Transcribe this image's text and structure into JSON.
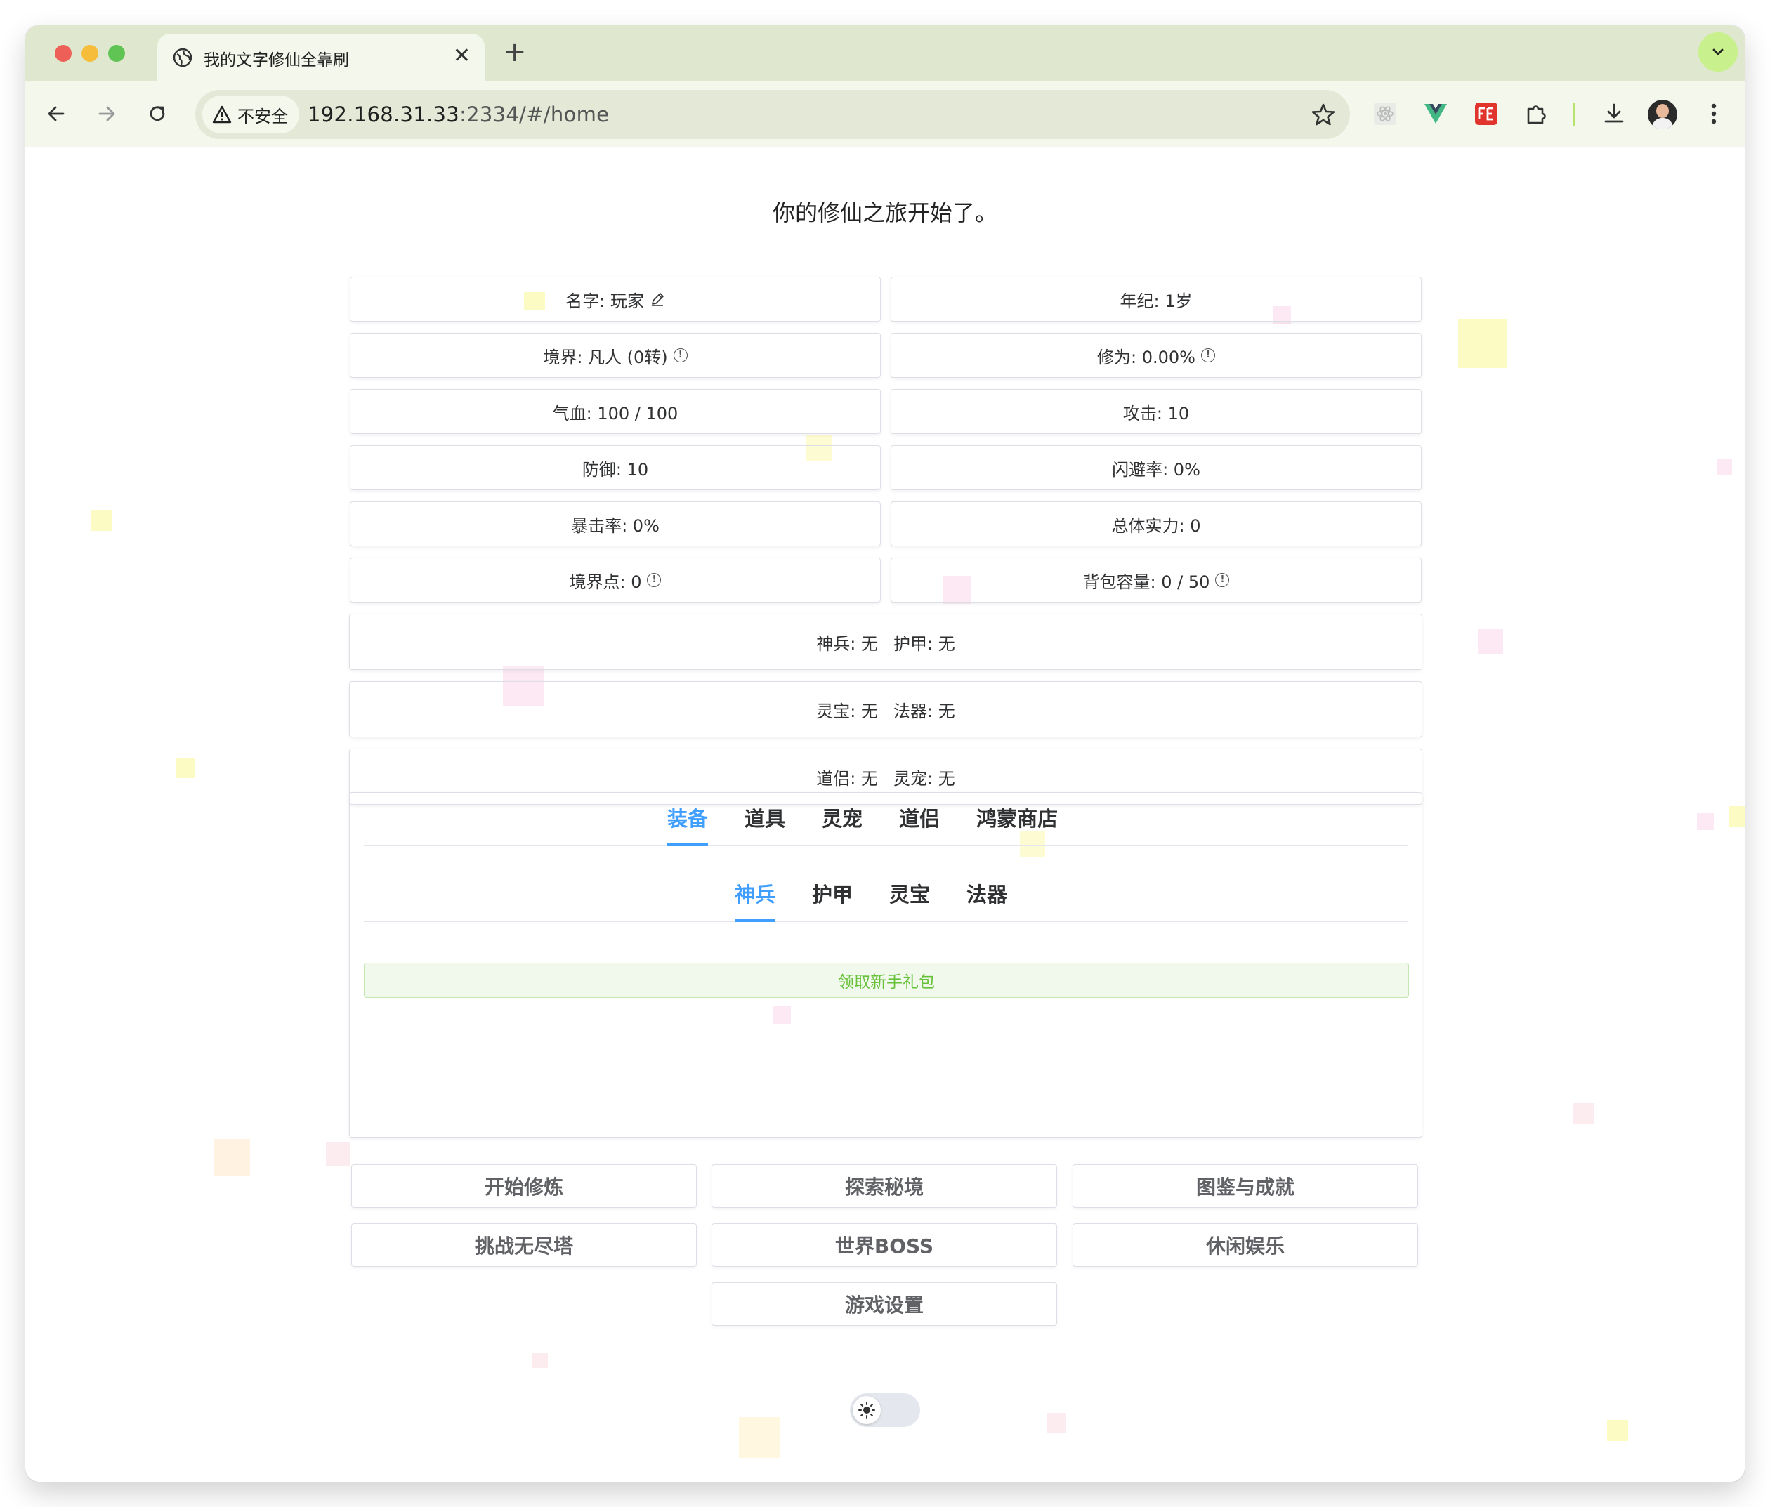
{
  "browser": {
    "tab_title": "我的文字修仙全靠刷",
    "tab_close": "✕",
    "new_tab": "+",
    "security_label": "不安全",
    "url_host": "192.168.31.33",
    "url_rest": ":2334/#/home"
  },
  "page": {
    "title": "你的修仙之旅开始了。"
  },
  "stats": {
    "name": "名字: 玩家",
    "age": "年纪: 1岁",
    "realm": "境界: 凡人 (0转)",
    "cultivation": "修为: 0.00%",
    "hp": "气血: 100 / 100",
    "attack": "攻击: 10",
    "defense": "防御: 10",
    "dodge": "闪避率: 0%",
    "crit": "暴击率: 0%",
    "power": "总体实力: 0",
    "realm_points": "境界点: 0",
    "bag": "背包容量: 0 / 50",
    "info_glyph": "!"
  },
  "equipment": {
    "weapon": "神兵: 无",
    "armor": "护甲: 无",
    "treasure": "灵宝: 无",
    "artifact": "法器: 无",
    "partner": "道侣: 无",
    "pet": "灵宠: 无"
  },
  "main_tabs": [
    "装备",
    "道具",
    "灵宠",
    "道侣",
    "鸿蒙商店"
  ],
  "sub_tabs": [
    "神兵",
    "护甲",
    "灵宝",
    "法器"
  ],
  "gift_button": "领取新手礼包",
  "actions": {
    "cultivate": "开始修炼",
    "explore": "探索秘境",
    "codex": "图鉴与成就",
    "tower": "挑战无尽塔",
    "boss": "世界BOSS",
    "leisure": "休闲娱乐",
    "settings": "游戏设置"
  },
  "colors": {
    "accent": "#409eff",
    "success": "#67c23a",
    "chrome_green": "#dfe8cf"
  }
}
